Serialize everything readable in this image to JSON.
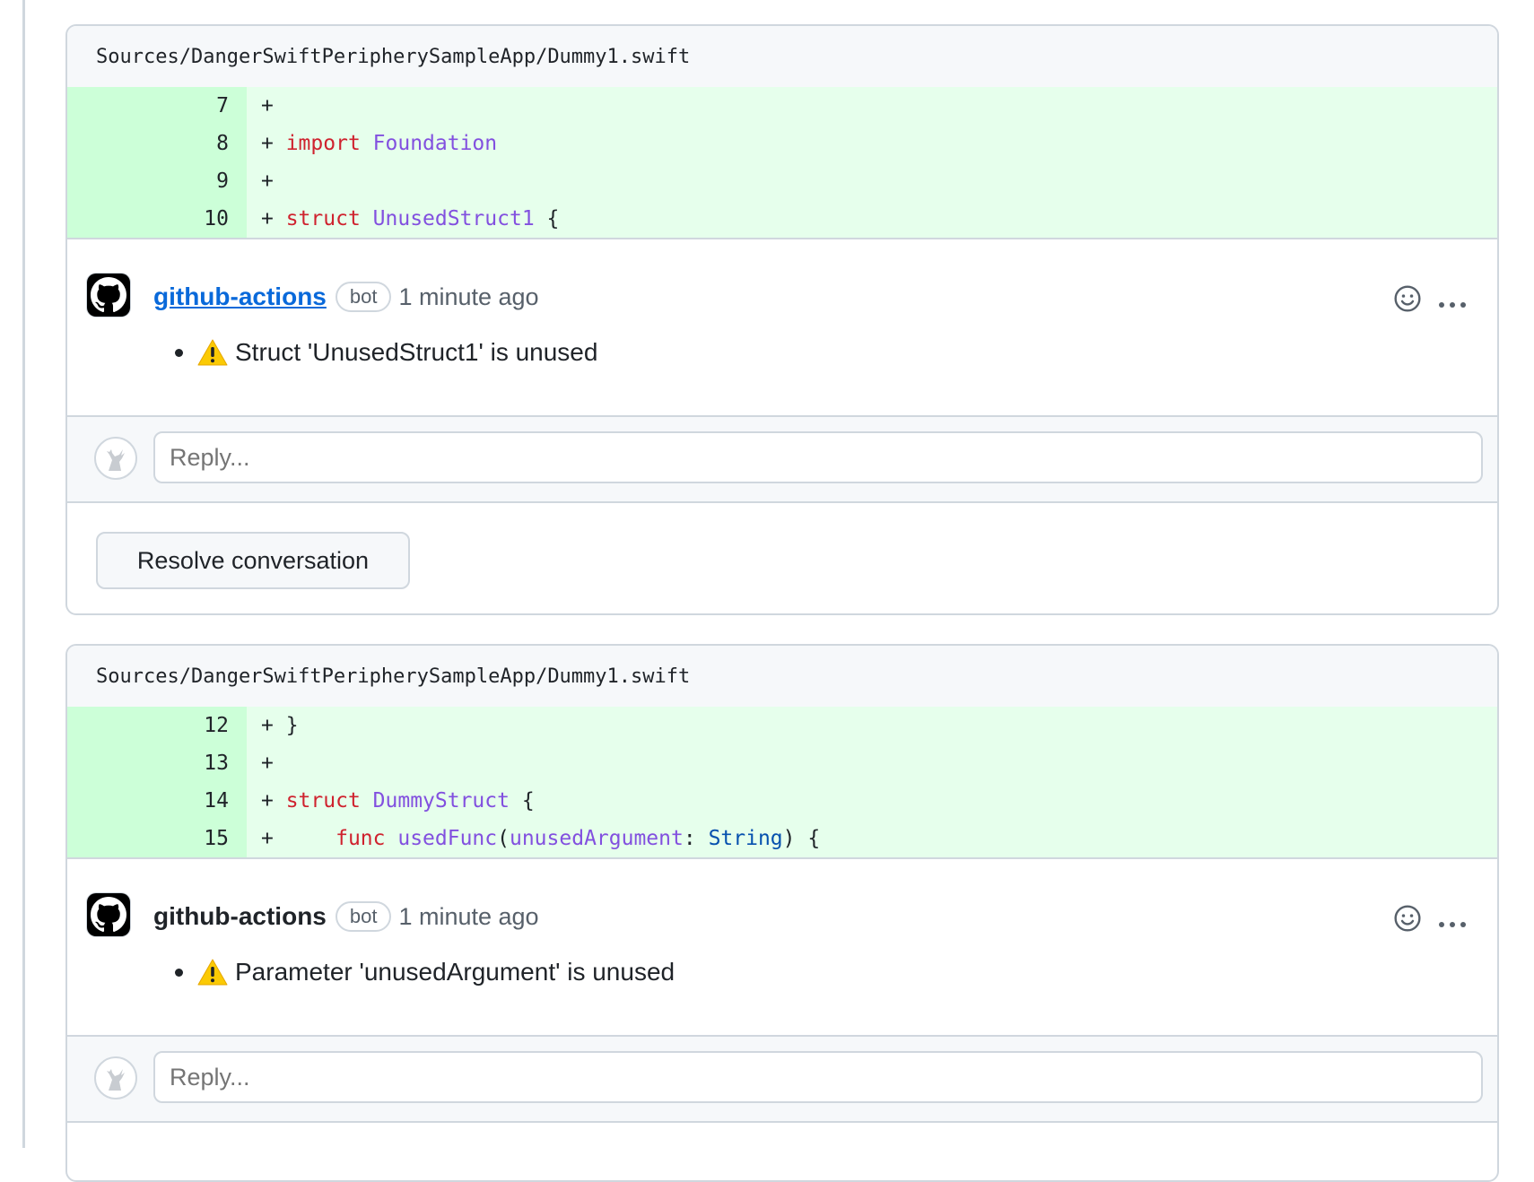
{
  "threads": [
    {
      "file_path": "Sources/DangerSwiftPeripherySampleApp/Dummy1.swift",
      "lines": [
        {
          "num": "7",
          "code": "+"
        },
        {
          "num": "8",
          "code": "+ import Foundation"
        },
        {
          "num": "9",
          "code": "+"
        },
        {
          "num": "10",
          "code": "+ struct UnusedStruct1 {"
        }
      ],
      "comment": {
        "author": "github-actions",
        "badge": "bot",
        "time": "1 minute ago",
        "message": "Struct 'UnusedStruct1' is unused"
      },
      "reply_placeholder": "Reply...",
      "resolve_label": "Resolve conversation"
    },
    {
      "file_path": "Sources/DangerSwiftPeripherySampleApp/Dummy1.swift",
      "lines": [
        {
          "num": "12",
          "code": "+ }"
        },
        {
          "num": "13",
          "code": "+"
        },
        {
          "num": "14",
          "code": "+ struct DummyStruct {"
        },
        {
          "num": "15",
          "code": "+     func usedFunc(unusedArgument: String) {"
        }
      ],
      "comment": {
        "author": "github-actions",
        "badge": "bot",
        "time": "1 minute ago",
        "message": "Parameter 'unusedArgument' is unused"
      },
      "reply_placeholder": "Reply..."
    }
  ],
  "icons": {
    "comment_actions": [
      "smiley-icon",
      "kebab-horizontal-icon"
    ],
    "warning": "warning-icon",
    "avatar": "github-mark-icon"
  },
  "colors": {
    "addition_line_bg": "#e6ffec",
    "addition_num_bg": "#ccffd8",
    "keyword": "#cf222e",
    "type": "#8250df",
    "link": "#0969da"
  }
}
